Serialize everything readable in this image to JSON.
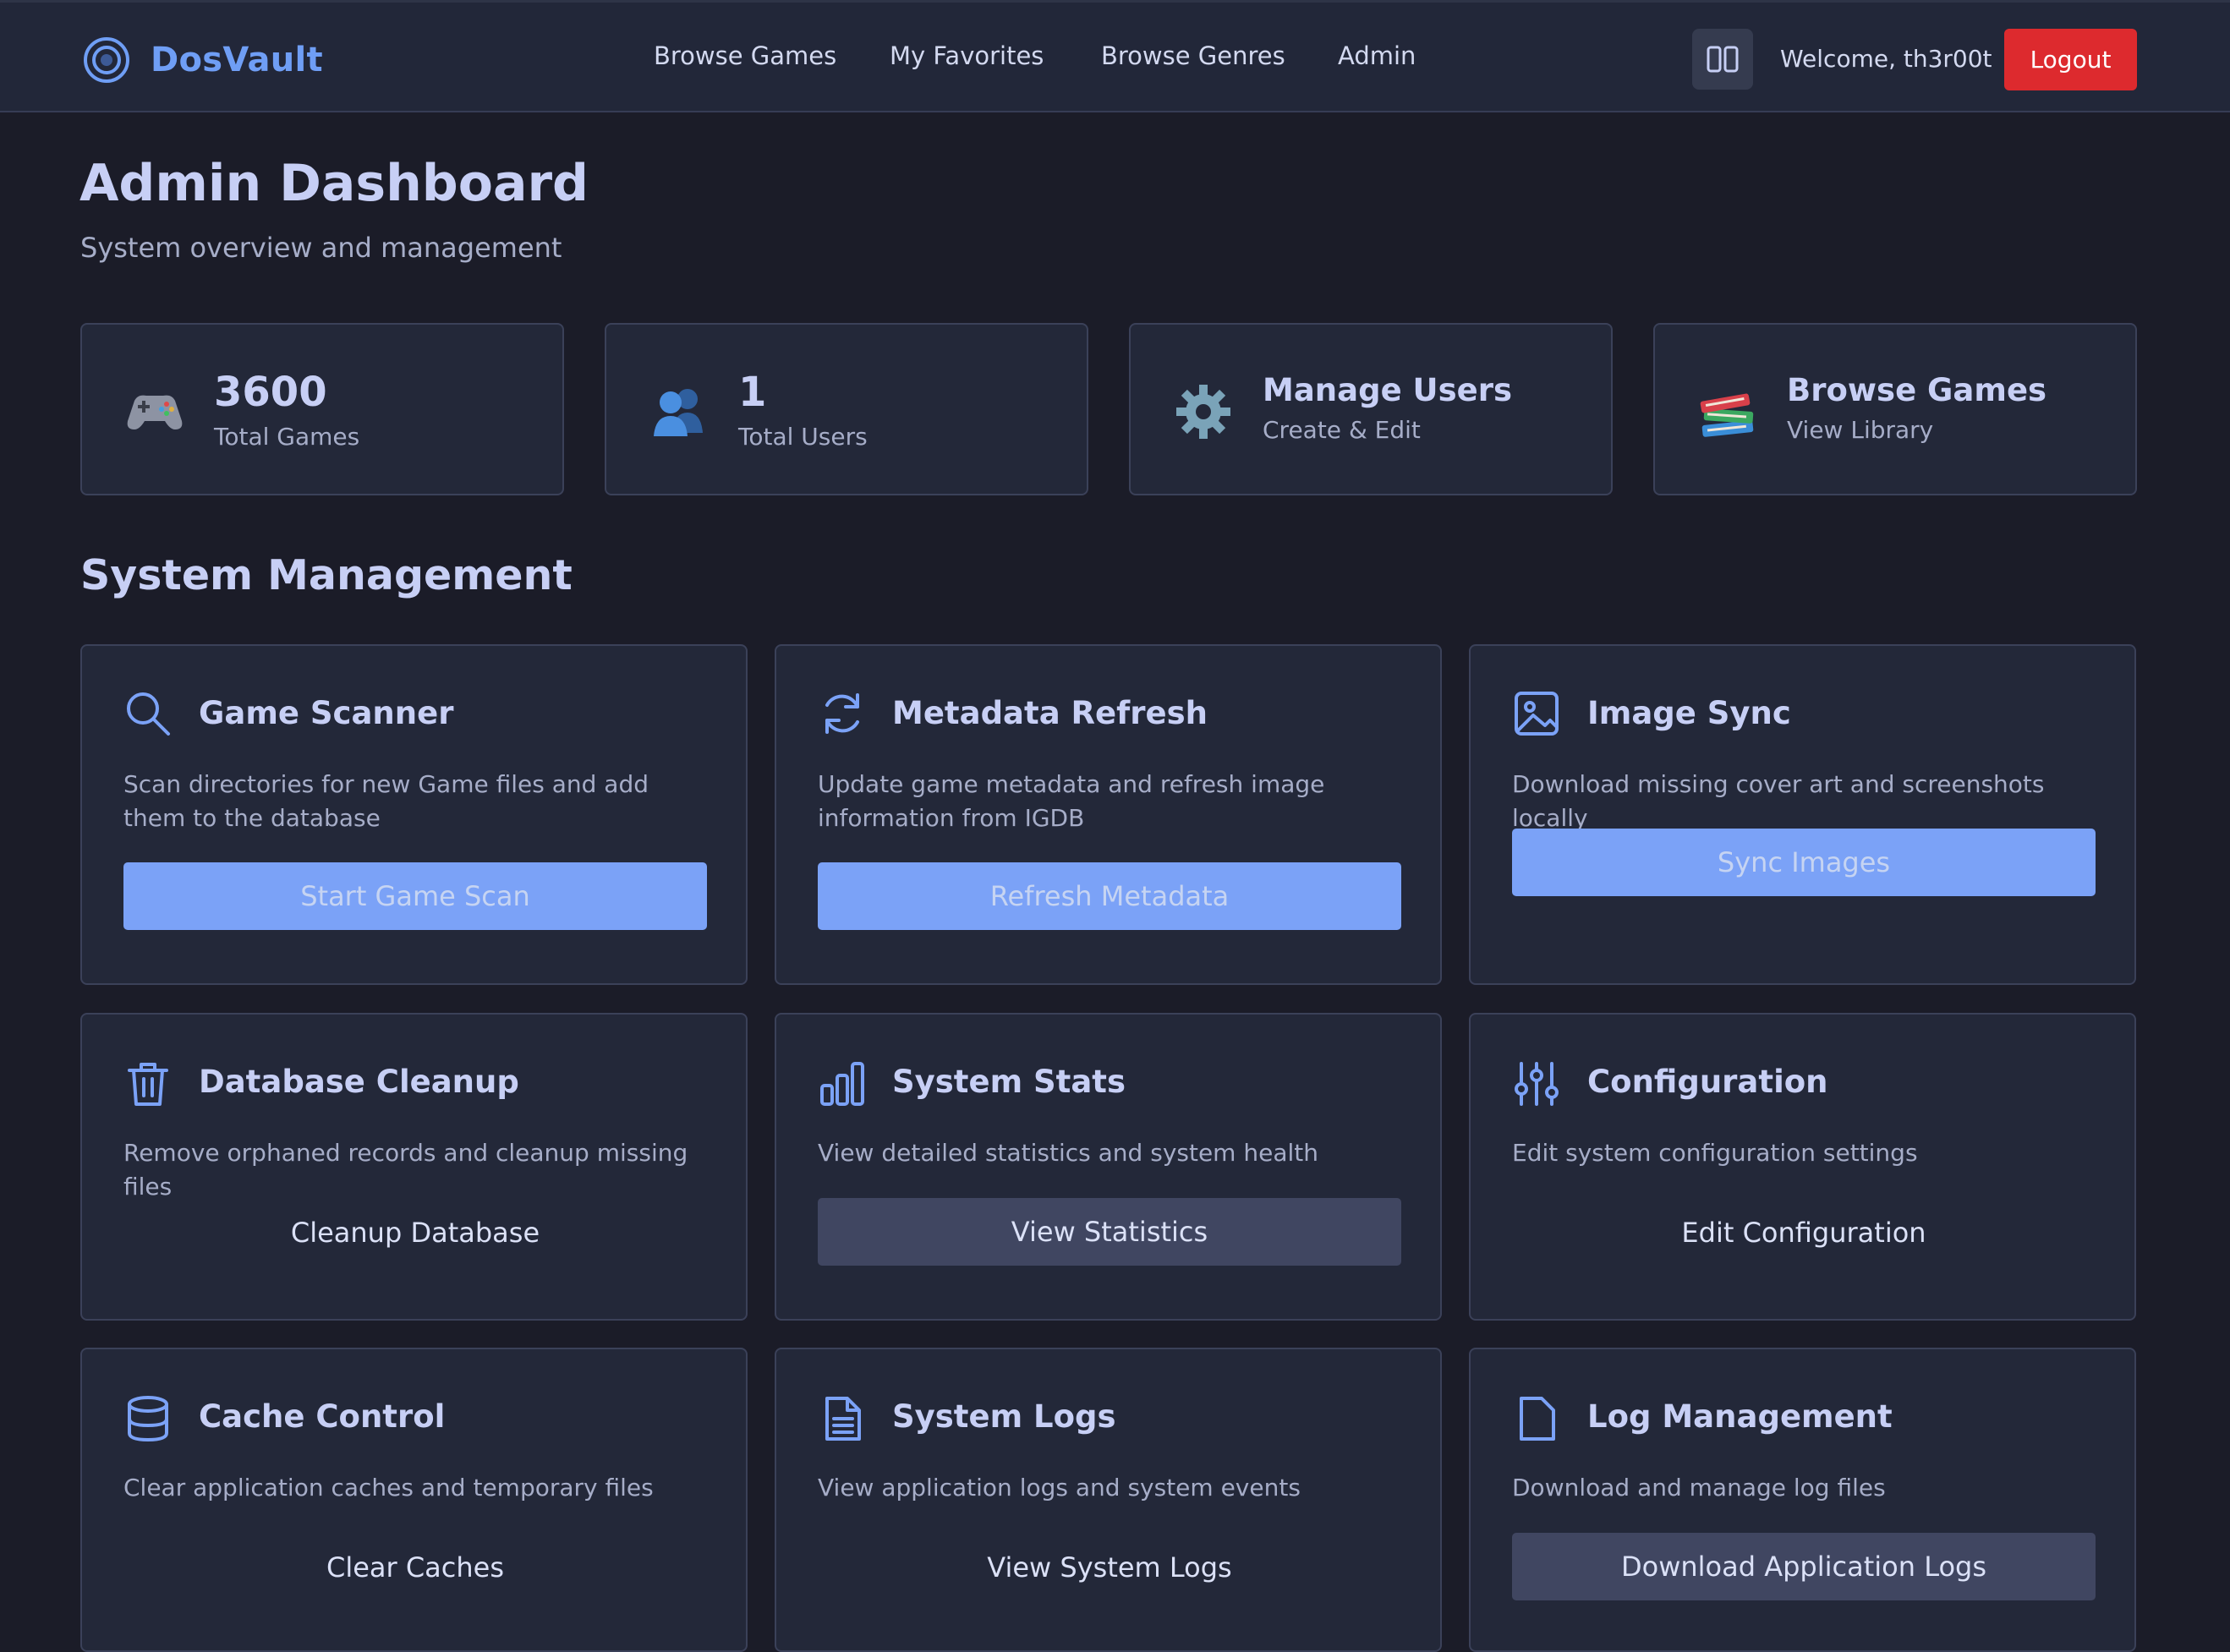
{
  "header": {
    "brand": "DosVault",
    "nav": [
      "Browse Games",
      "My Favorites",
      "Browse Genres",
      "Admin"
    ],
    "welcome": "Welcome, th3r00t",
    "logout": "Logout"
  },
  "page": {
    "title": "Admin Dashboard",
    "subtitle": "System overview and management"
  },
  "stats": [
    {
      "icon": "gamepad-icon",
      "value": "3600",
      "label": "Total Games"
    },
    {
      "icon": "users-icon",
      "value": "1",
      "label": "Total Users"
    },
    {
      "icon": "gear-icon",
      "title": "Manage Users",
      "label": "Create & Edit"
    },
    {
      "icon": "books-icon",
      "title": "Browse Games",
      "label": "View Library"
    }
  ],
  "section_title": "System Management",
  "cards": [
    {
      "icon": "search-icon",
      "title": "Game Scanner",
      "desc": "Scan directories for new Game files and add them to the database",
      "button": "Start Game Scan",
      "style": "primary"
    },
    {
      "icon": "refresh-icon",
      "title": "Metadata Refresh",
      "desc": "Update game metadata and refresh image information from IGDB",
      "button": "Refresh Metadata",
      "style": "primary"
    },
    {
      "icon": "image-icon",
      "title": "Image Sync",
      "desc": "Download missing cover art and screenshots locally",
      "button": "Sync Images",
      "style": "primary"
    },
    {
      "icon": "trash-icon",
      "title": "Database Cleanup",
      "desc": "Remove orphaned records and cleanup missing files",
      "button": "Cleanup Database",
      "style": "ghost"
    },
    {
      "icon": "bar-chart-icon",
      "title": "System Stats",
      "desc": "View detailed statistics and system health",
      "button": "View Statistics",
      "style": "secondary"
    },
    {
      "icon": "sliders-icon",
      "title": "Configuration",
      "desc": "Edit system configuration settings",
      "button": "Edit Configuration",
      "style": "ghost"
    },
    {
      "icon": "database-icon",
      "title": "Cache Control",
      "desc": "Clear application caches and temporary files",
      "button": "Clear Caches",
      "style": "ghost"
    },
    {
      "icon": "document-icon",
      "title": "System Logs",
      "desc": "View application logs and system events",
      "button": "View System Logs",
      "style": "ghost"
    },
    {
      "icon": "file-icon",
      "title": "Log Management",
      "desc": "Download and manage log files",
      "button": "Download Application Logs",
      "style": "secondary"
    }
  ],
  "colors": {
    "background": "#1b1c28",
    "card": "#232839",
    "accent": "#6f9ef5",
    "primary_button": "#7ba2f7",
    "logout": "#dd2a2e"
  }
}
